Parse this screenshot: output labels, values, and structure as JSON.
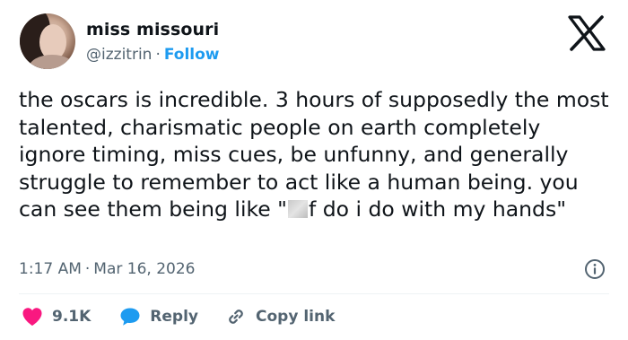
{
  "user": {
    "display_name": "miss missouri",
    "handle": "@izzitrin",
    "separator": "·",
    "follow_label": "Follow"
  },
  "tweet": {
    "text_part1": "the oscars is incredible. 3 hours of supposedly the most talented, charismatic people on earth completely ignore timing, miss cues, be unfunny, and generally struggle to remember to act like a human being. you can see them being like \"",
    "text_part2": "f do i do with my hands\""
  },
  "meta": {
    "time": "1:17 AM",
    "separator": "·",
    "date": "Mar 16, 2026"
  },
  "actions": {
    "likes": "9.1K",
    "reply_label": "Reply",
    "copy_label": "Copy link"
  },
  "icons": {
    "logo": "x-logo-icon",
    "info": "info-icon",
    "like": "heart-icon",
    "reply": "speech-bubble-icon",
    "copy": "link-icon"
  },
  "colors": {
    "text": "#0f1419",
    "secondary": "#536471",
    "accent": "#1d9bf0",
    "like": "#f91880",
    "divider": "#eff3f4"
  }
}
